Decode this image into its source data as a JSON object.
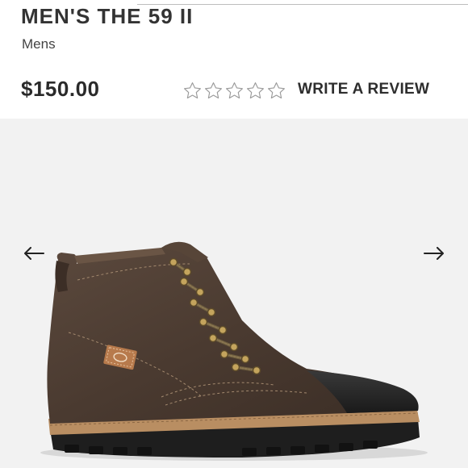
{
  "product": {
    "title": "MEN'S THE 59 II",
    "category": "Mens",
    "price": "$150.00"
  },
  "rating": {
    "stars_filled": 0,
    "stars_total": 5,
    "review_link": "WRITE A REVIEW"
  },
  "gallery": {
    "image": "dark brown leather lace-up boot",
    "prev_icon": "arrow-left-icon",
    "next_icon": "arrow-right-icon"
  },
  "colors": {
    "background": "#ffffff",
    "gallery_background": "#f2f2f2",
    "text": "#2a2a2a",
    "star_outline": "#9a9a9a",
    "boot_leather": "#4a3a30"
  }
}
